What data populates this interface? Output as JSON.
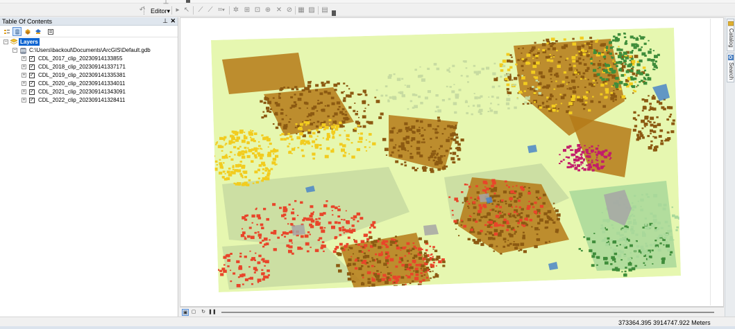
{
  "toolbar": {
    "editor_label": "Editor",
    "editor_arrow": "▾"
  },
  "toc": {
    "title": "Table Of Contents",
    "pin_glyph": "ᵖ",
    "close_glyph": "✕",
    "root_label": "Layers",
    "workspace_path": "C:\\Users\\backoul\\Documents\\ArcGIS\\Default.gdb",
    "layers": [
      {
        "name": "CDL_2017_clip_20230914133855",
        "checked": true
      },
      {
        "name": "CDL_2018_clip_202309141337171",
        "checked": true
      },
      {
        "name": "CDL_2019_clip_202309141335381",
        "checked": true
      },
      {
        "name": "CDL_2020_clip_202309141334011",
        "checked": true
      },
      {
        "name": "CDL_2021_clip_202309141343091",
        "checked": true
      },
      {
        "name": "CDL_2022_clip_202309141328411",
        "checked": true
      }
    ]
  },
  "dock": {
    "catalog_label": "Catalog",
    "search_label": "Search"
  },
  "status": {
    "coordinates": "373364.395  3914747.922 Meters"
  },
  "map": {
    "palette": {
      "background_crop": "#e6f7b0",
      "grassland": "#c7dba1",
      "corn_yellow": "#f2cc1f",
      "soy_brown": "#b57a18",
      "dark_brown": "#8c5a12",
      "red_crop": "#e8452a",
      "magenta_crop": "#c21d6b",
      "urban_gray": "#a6a6a6",
      "water_blue": "#4a86c8",
      "forest_green": "#3f8d3b",
      "light_green": "#a8d89a"
    }
  },
  "colors": {
    "selection_blue": "#0a63d1",
    "toc_header": "#dfe6ee"
  }
}
